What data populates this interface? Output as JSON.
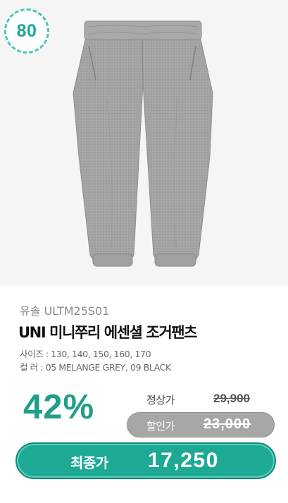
{
  "badge": {
    "text": "80"
  },
  "product": {
    "brand": "유솔 ULTM25S01",
    "title": "UNI 미니쭈리 에센셜 조거팬츠",
    "size_line": "사이즈 : 130, 140, 150, 160, 170",
    "color_line": "컬    러 : 05 MELANGE GREY, 09 BLACK"
  },
  "pricing": {
    "discount": "42%",
    "regular_label": "정상가",
    "regular_price": "29,900",
    "sale_label": "할인가",
    "sale_price": "23,000",
    "final_label": "최종가",
    "final_price": "17,250"
  },
  "colors": {
    "accent": "#1ea995",
    "badge_border": "#4cc8b8",
    "sale_pill": "#a7a7a7"
  },
  "icons": {
    "product_image": "grey-jogger-pants-image"
  }
}
